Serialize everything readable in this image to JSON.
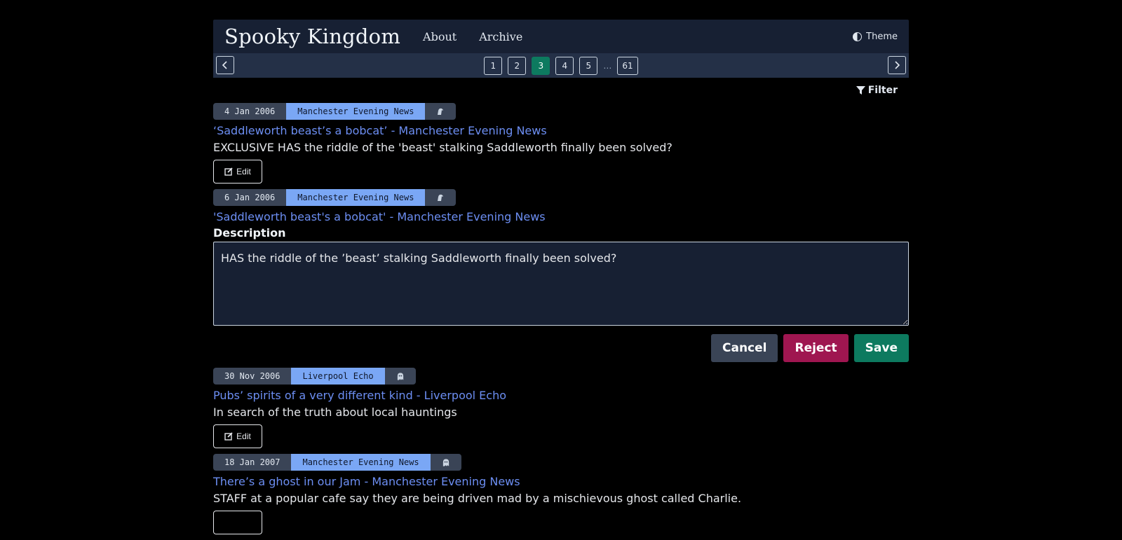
{
  "header": {
    "brand": "Spooky Kingdom",
    "nav": [
      "About",
      "Archive"
    ],
    "theme_label": "Theme"
  },
  "pagination": {
    "pages": [
      "1",
      "2",
      "3",
      "4",
      "5"
    ],
    "current": "3",
    "ellipsis": "…",
    "last": "61"
  },
  "filter_label": "Filter",
  "items": [
    {
      "date": "4 Jan 2006",
      "source": "Manchester Evening News",
      "kind_icon": "creature-icon",
      "title": "‘Saddleworth beast’s a bobcat’ - Manchester Evening News",
      "description": "EXCLUSIVE HAS the riddle of the 'beast' stalking Saddleworth finally been solved?",
      "edit_label": "Edit"
    },
    {
      "date": "6 Jan 2006",
      "source": "Manchester Evening News",
      "kind_icon": "creature-icon",
      "title": "'Saddleworth beast's a bobcat' - Manchester Evening News",
      "editing": true,
      "description_label": "Description",
      "description_value": "HAS the riddle of the ’beast’ stalking Saddleworth finally been solved?",
      "cancel_label": "Cancel",
      "reject_label": "Reject",
      "save_label": "Save"
    },
    {
      "date": "30 Nov 2006",
      "source": "Liverpool Echo",
      "kind_icon": "ghost-icon",
      "title": "Pubs’ spirits of a very different kind - Liverpool Echo",
      "description": "In search of the truth about local hauntings",
      "edit_label": "Edit"
    },
    {
      "date": "18 Jan 2007",
      "source": "Manchester Evening News",
      "kind_icon": "ghost-icon",
      "title": "There’s a ghost in our Jam - Manchester Evening News",
      "description": "STAFF at a popular cafe say they are being driven mad by a mischievous ghost called Charlie."
    }
  ],
  "colors": {
    "accent": "#0d7a5f",
    "link": "#6c8ef2",
    "source_tag": "#7aa7f5",
    "reject": "#9f1650"
  }
}
